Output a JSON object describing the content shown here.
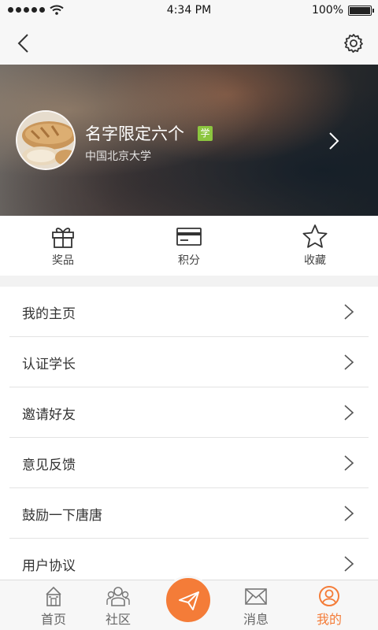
{
  "status_bar": {
    "time": "4:34 PM",
    "battery": "100%"
  },
  "nav": {
    "back_icon": "back-icon",
    "settings_icon": "gear-icon"
  },
  "profile": {
    "name": "名字限定六个",
    "badge": "学",
    "school": "中国北京大学",
    "badge_color": "#8cc63f"
  },
  "quick_actions": [
    {
      "label": "奖品",
      "icon": "gift-icon"
    },
    {
      "label": "积分",
      "icon": "card-icon"
    },
    {
      "label": "收藏",
      "icon": "star-icon"
    }
  ],
  "menu": [
    {
      "label": "我的主页"
    },
    {
      "label": "认证学长"
    },
    {
      "label": "邀请好友"
    },
    {
      "label": "意见反馈"
    },
    {
      "label": "鼓励一下唐唐"
    },
    {
      "label": "用户协议"
    }
  ],
  "tabs": [
    {
      "label": "首页",
      "icon": "home-icon"
    },
    {
      "label": "社区",
      "icon": "community-icon"
    },
    {
      "label": "消息",
      "icon": "mail-icon"
    },
    {
      "label": "我的",
      "icon": "profile-icon",
      "active": true
    }
  ],
  "accent_color": "#f47c38"
}
